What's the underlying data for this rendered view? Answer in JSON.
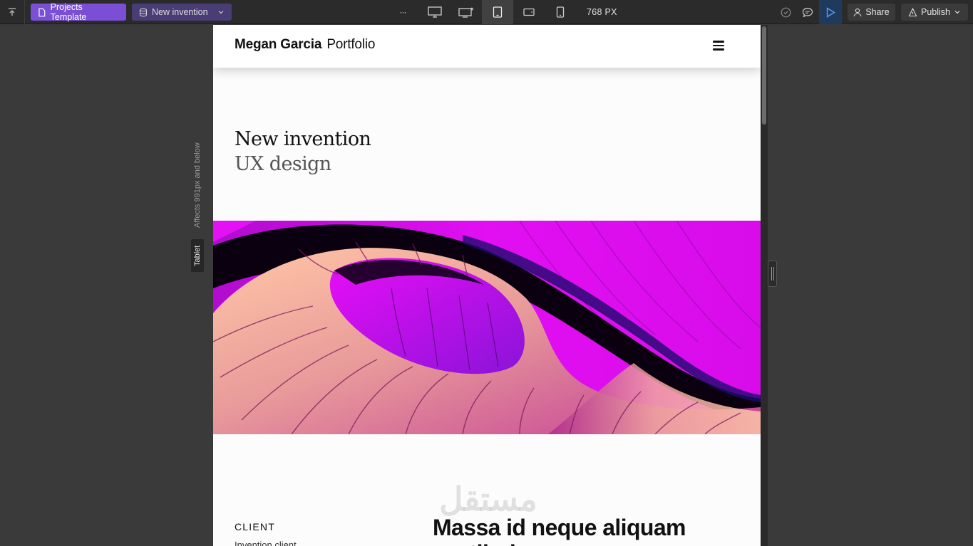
{
  "toolbar": {
    "project_label": "Projects Template",
    "page_label": "New invention",
    "more_label": "···",
    "width_readout": "768 PX",
    "share_label": "Share",
    "publish_label": "Publish",
    "icons": {
      "collapse": "arrow-up-bar-icon",
      "project": "page-icon",
      "page": "database-icon",
      "desktop": "desktop-icon",
      "desktop_star": "desktop-star-icon",
      "tablet": "tablet-icon",
      "mobile_landscape": "mobile-landscape-icon",
      "mobile": "mobile-portrait-icon",
      "check": "check-circle-icon",
      "comment": "comment-icon",
      "play": "play-icon",
      "user": "user-icon",
      "publish": "rocket-icon"
    },
    "colors": {
      "accent": "#7a4fd6",
      "page_pill": "#4a3c74",
      "play_bg": "#1f3a5c"
    }
  },
  "breakpoint": {
    "affects": "Affects 991px and below",
    "device": "Tablet"
  },
  "site": {
    "brand_name": "Megan Garcia",
    "brand_suffix": "Portfolio",
    "hero_title": "New invention",
    "hero_subtitle": "UX design",
    "client_label": "CLIENT",
    "client_value": "Invention client",
    "headline_line1": "Massa id neque aliquam",
    "headline_line2": "vestibulum"
  },
  "watermark": "مستقل"
}
